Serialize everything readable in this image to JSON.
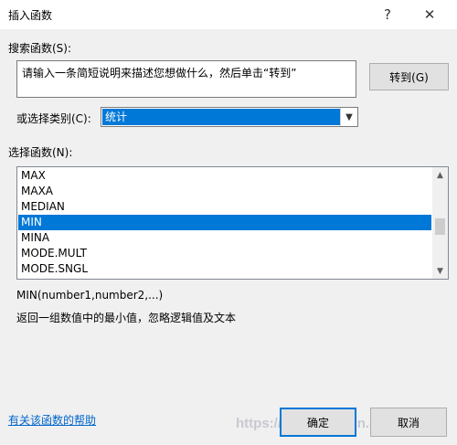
{
  "window": {
    "title": "插入函数",
    "help_glyph": "?",
    "close_glyph": "✕"
  },
  "search": {
    "label": "搜索函数(S):",
    "value": "请输入一条简短说明来描述您想做什么，然后单击“转到”",
    "go_button": "转到(G)"
  },
  "category": {
    "label": "或选择类别(C):",
    "selected": "统计"
  },
  "function_list": {
    "label": "选择函数(N):",
    "items": [
      "MAX",
      "MAXA",
      "MEDIAN",
      "MIN",
      "MINA",
      "MODE.MULT",
      "MODE.SNGL"
    ],
    "selected_index": 3
  },
  "description": {
    "syntax": "MIN(number1,number2,...)",
    "text": "返回一组数值中的最小值，忽略逻辑值及文本"
  },
  "footer": {
    "help_link": "有关该函数的帮助",
    "ok_button": "确定",
    "cancel_button": "取消"
  },
  "watermark": "https://www.Yzdmin.cc"
}
